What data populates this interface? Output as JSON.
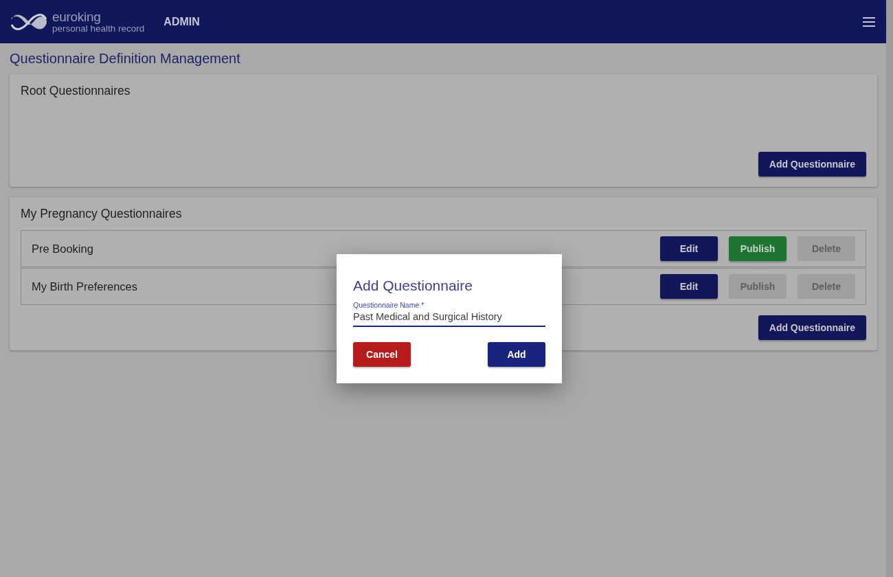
{
  "header": {
    "brand": "euroking",
    "tagline": "personal health record",
    "section": "ADMIN"
  },
  "page_title": "Questionnaire Definition Management",
  "groups": [
    {
      "title": "Root Questionnaires",
      "add_button": "Add Questionnaire"
    },
    {
      "title": "My Pregnancy Questionnaires",
      "add_button": "Add Questionnaire",
      "items": [
        {
          "name": "Pre Booking",
          "actions": [
            {
              "label": "Edit",
              "kind": "edit",
              "disabled": false
            },
            {
              "label": "Publish",
              "kind": "publish",
              "disabled": false
            },
            {
              "label": "Delete",
              "kind": "delete",
              "disabled": true
            }
          ]
        },
        {
          "name": "My Birth Preferences",
          "actions": [
            {
              "label": "Edit",
              "kind": "edit",
              "disabled": false
            },
            {
              "label": "Publish",
              "kind": "publish",
              "disabled": true
            },
            {
              "label": "Delete",
              "kind": "delete",
              "disabled": true
            }
          ]
        }
      ]
    }
  ],
  "dialog": {
    "title": "Add Questionnaire",
    "field": {
      "label": "Questionnaire Name *",
      "value": "Past Medical and Surgical History"
    },
    "buttons": [
      {
        "label": "Cancel",
        "kind": "cancel"
      },
      {
        "label": "Add",
        "kind": "confirm"
      }
    ]
  }
}
